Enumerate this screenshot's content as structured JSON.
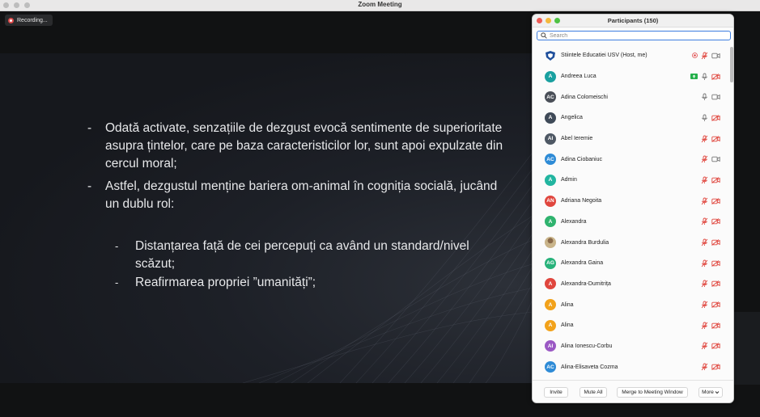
{
  "window": {
    "title": "Zoom Meeting"
  },
  "recording": {
    "label": "Recording..."
  },
  "slide": {
    "bullet_marker": "-",
    "sub_marker": "-",
    "bullets": [
      "Odată activate, senzațiile de dezgust evocă sentimente de superioritate asupra țintelor, care pe baza caracteristicilor lor, sunt apoi expulzate din cercul moral;",
      "Astfel, dezgustul menține bariera om-animal în cogniția socială, jucând un dublu rol:"
    ],
    "sub_bullets": [
      "Distanțarea față de cei percepuți ca având un standard/nivel scăzut;",
      "Reafirmarea propriei ”umanități”;"
    ]
  },
  "participants": {
    "title": "Participants (150)",
    "search_placeholder": "Search",
    "list": [
      {
        "name": "Stiintele Educatiei USV (Host, me)",
        "initials": "",
        "color": "#1f4f9c",
        "avatar_type": "logo",
        "mic": "muted",
        "video": "on",
        "extra": "record-dot"
      },
      {
        "name": "Andreea Luca",
        "initials": "A",
        "color": "#1aa0a0",
        "mic": "on",
        "video": "off",
        "extra": "share"
      },
      {
        "name": "Adina Colomeischi",
        "initials": "AC",
        "color": "#4a4f58",
        "mic": "on",
        "video": "on"
      },
      {
        "name": "Angelica",
        "initials": "A",
        "color": "#3f4a58",
        "mic": "on",
        "video": "off"
      },
      {
        "name": "Abel Ieremie",
        "initials": "AI",
        "color": "#4e5864",
        "mic": "muted",
        "video": "off"
      },
      {
        "name": "Adina Ciobaniuc",
        "initials": "AC",
        "color": "#2e8bd6",
        "mic": "muted",
        "video": "on"
      },
      {
        "name": "Admin",
        "initials": "A",
        "color": "#22b5a0",
        "mic": "muted",
        "video": "off"
      },
      {
        "name": "Adriana Negoita",
        "initials": "AN",
        "color": "#e0463e",
        "mic": "muted",
        "video": "off"
      },
      {
        "name": "Alexandra",
        "initials": "A",
        "color": "#2fb36e",
        "mic": "muted",
        "video": "off"
      },
      {
        "name": "Alexandra Burdulia",
        "initials": "",
        "color": "#c9b48a",
        "avatar_type": "photo",
        "mic": "muted",
        "video": "off"
      },
      {
        "name": "Alexandra Gaina",
        "initials": "AG",
        "color": "#27b27a",
        "mic": "muted",
        "video": "off"
      },
      {
        "name": "Alexandra-Dumitrița",
        "initials": "A",
        "color": "#e0463e",
        "mic": "muted",
        "video": "off"
      },
      {
        "name": "Alina",
        "initials": "A",
        "color": "#f2a21b",
        "mic": "muted",
        "video": "off"
      },
      {
        "name": "Alina",
        "initials": "A",
        "color": "#f2a21b",
        "mic": "muted",
        "video": "off"
      },
      {
        "name": "Alina Ionescu-Corbu",
        "initials": "AI",
        "color": "#9b59c4",
        "mic": "muted",
        "video": "off"
      },
      {
        "name": "Alina-Elisaveta Cozma",
        "initials": "AC",
        "color": "#2e8bd6",
        "mic": "muted",
        "video": "off"
      }
    ],
    "footer": {
      "invite": "Invite",
      "mute_all": "Mute All",
      "merge": "Merge to Meeting Window",
      "more": "More"
    }
  },
  "colors": {
    "muted_icon": "#e0463e",
    "ok_icon": "#777777",
    "search_border": "#3f7fe0",
    "share_badge": "#23b04a"
  }
}
